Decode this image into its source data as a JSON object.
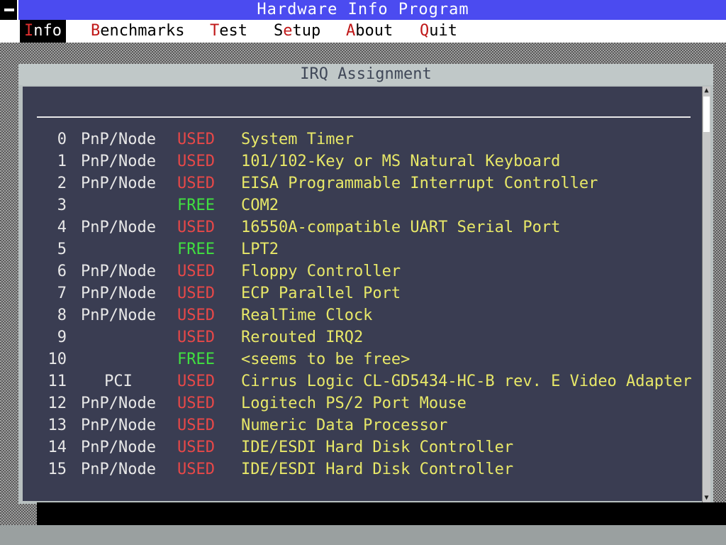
{
  "app": {
    "title": "Hardware Info Program"
  },
  "menu": [
    {
      "hot": "I",
      "rest": "nfo",
      "active": true
    },
    {
      "hot": "B",
      "rest": "enchmarks",
      "active": false
    },
    {
      "hot": "T",
      "rest": "est",
      "active": false
    },
    {
      "hot": "S",
      "rest": "etup",
      "hot_index": 1,
      "active": false
    },
    {
      "hot": "A",
      "rest": "bout",
      "active": false
    },
    {
      "hot": "Q",
      "rest": "uit",
      "active": false
    }
  ],
  "window": {
    "title": "IRQ Assignment"
  },
  "colors": {
    "used": "#e84848",
    "free": "#40e040",
    "device": "#e8e868",
    "title_bar": "#4b4bf0",
    "content_bg": "#3a3d52"
  },
  "irq_rows": [
    {
      "num": "0",
      "bus": "PnP/Node",
      "state": "USED",
      "device": "System Timer"
    },
    {
      "num": "1",
      "bus": "PnP/Node",
      "state": "USED",
      "device": "101/102-Key or MS Natural Keyboard"
    },
    {
      "num": "2",
      "bus": "PnP/Node",
      "state": "USED",
      "device": "EISA Programmable Interrupt Controller"
    },
    {
      "num": "3",
      "bus": "",
      "state": "FREE",
      "device": "COM2"
    },
    {
      "num": "4",
      "bus": "PnP/Node",
      "state": "USED",
      "device": "16550A-compatible UART Serial Port"
    },
    {
      "num": "5",
      "bus": "",
      "state": "FREE",
      "device": "LPT2"
    },
    {
      "num": "6",
      "bus": "PnP/Node",
      "state": "USED",
      "device": "Floppy Controller"
    },
    {
      "num": "7",
      "bus": "PnP/Node",
      "state": "USED",
      "device": "ECP Parallel Port"
    },
    {
      "num": "8",
      "bus": "PnP/Node",
      "state": "USED",
      "device": "RealTime Clock"
    },
    {
      "num": "9",
      "bus": "",
      "state": "USED",
      "device": "Rerouted IRQ2"
    },
    {
      "num": "10",
      "bus": "",
      "state": "FREE",
      "device": "<seems to be free>"
    },
    {
      "num": "11",
      "bus": "PCI",
      "state": "USED",
      "device": "Cirrus Logic CL-GD5434-HC-B rev. E Video Adapter"
    },
    {
      "num": "12",
      "bus": "PnP/Node",
      "state": "USED",
      "device": "Logitech PS/2 Port Mouse"
    },
    {
      "num": "13",
      "bus": "PnP/Node",
      "state": "USED",
      "device": "Numeric Data Processor"
    },
    {
      "num": "14",
      "bus": "PnP/Node",
      "state": "USED",
      "device": "IDE/ESDI Hard Disk Controller"
    },
    {
      "num": "15",
      "bus": "PnP/Node",
      "state": "USED",
      "device": "IDE/ESDI Hard Disk Controller"
    }
  ]
}
